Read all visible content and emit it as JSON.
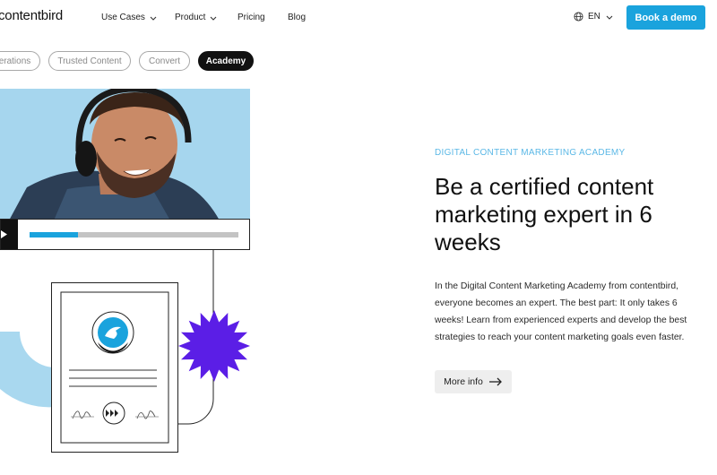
{
  "nav": {
    "logo": "contentbird",
    "items": [
      {
        "label": "Use Cases",
        "has_dropdown": true
      },
      {
        "label": "Product",
        "has_dropdown": true
      },
      {
        "label": "Pricing",
        "has_dropdown": false
      },
      {
        "label": "Blog",
        "has_dropdown": false
      }
    ],
    "language": "EN",
    "cta_label": "Book a demo"
  },
  "tabs": [
    {
      "label": "erations",
      "active": false
    },
    {
      "label": "Trusted Content",
      "active": false
    },
    {
      "label": "Convert",
      "active": false
    },
    {
      "label": "Academy",
      "active": true
    }
  ],
  "video": {
    "progress": 0.23
  },
  "content": {
    "eyebrow": "DIGITAL CONTENT MARKETING ACADEMY",
    "headline": "Be a certified content marketing expert in 6 weeks",
    "body": "In the Digital Content Marketing Academy from contentbird, everyone becomes an expert. The best part: It only takes 6 weeks! Learn from experienced experts and develop the best strategies to reach your content marketing goals even faster.",
    "more_label": "More info"
  },
  "colors": {
    "accent": "#1aa3dd",
    "eyebrow": "#5bb8e6",
    "badge": "#5b1ee6",
    "light_blue_shape": "#a9d8ef"
  },
  "icons": [
    "globe-icon",
    "chevron-down-icon",
    "play-icon",
    "arrow-right-icon",
    "bird-icon",
    "signature-icon",
    "fast-forward-icon",
    "star-badge-icon"
  ]
}
